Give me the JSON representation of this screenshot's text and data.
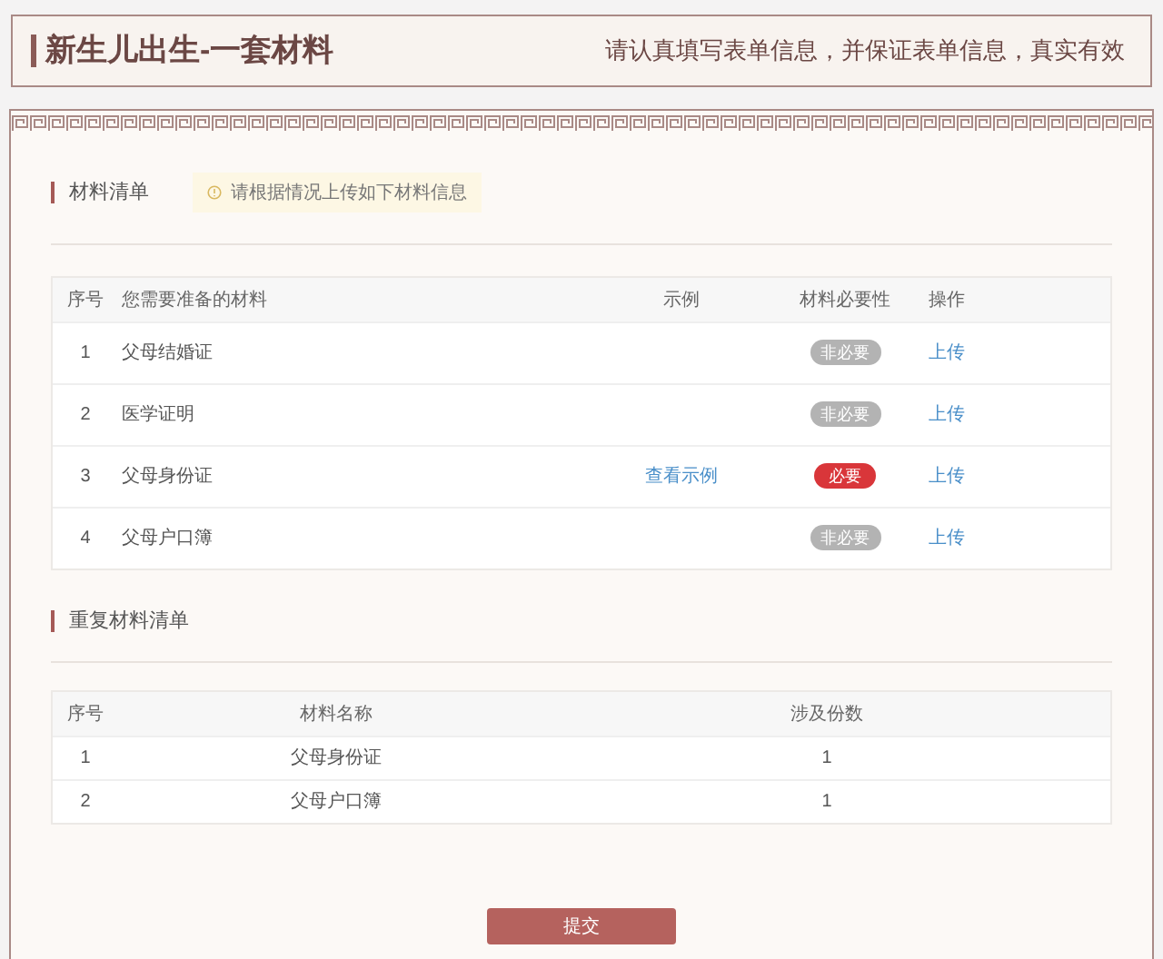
{
  "header": {
    "title": "新生儿出生-一套材料",
    "notice": "请认真填写表单信息，并保证表单信息，真实有效"
  },
  "materials": {
    "title": "材料清单",
    "tip": "请根据情况上传如下材料信息",
    "columns": [
      "序号",
      "您需要准备的材料",
      "示例",
      "材料必要性",
      "操作"
    ],
    "rows": [
      {
        "no": "1",
        "name": "父母结婚证",
        "necessity": "非必要",
        "required": false,
        "action": "上传"
      },
      {
        "no": "2",
        "name": "医学证明",
        "necessity": "非必要",
        "required": false,
        "action": "上传"
      },
      {
        "no": "3",
        "name": "父母身份证",
        "example": "查看示例",
        "necessity": "必要",
        "required": true,
        "action": "上传"
      },
      {
        "no": "4",
        "name": "父母户口簿",
        "necessity": "非必要",
        "required": false,
        "action": "上传"
      }
    ]
  },
  "duplicates": {
    "title": "重复材料清单",
    "columns": [
      "序号",
      "材料名称",
      "涉及份数"
    ],
    "rows": [
      {
        "no": "1",
        "name": "父母身份证",
        "count": "1"
      },
      {
        "no": "2",
        "name": "父母户口簿",
        "count": "1"
      }
    ]
  },
  "submit": "提交"
}
